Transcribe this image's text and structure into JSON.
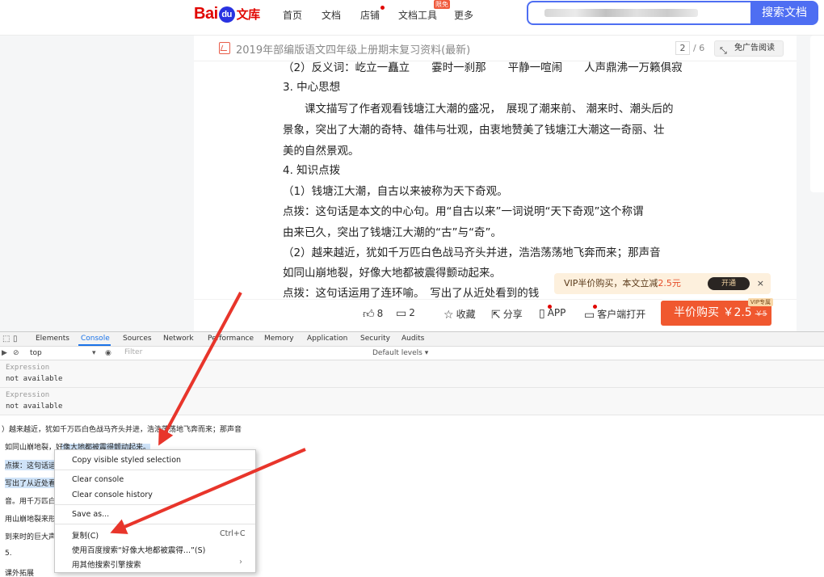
{
  "header": {
    "logo_brand": "Bai",
    "logo_paw": "du",
    "logo_suffix": "文库",
    "nav": [
      "首页",
      "文档",
      "店铺",
      "文档工具",
      "更多"
    ],
    "hot_badge": "限免",
    "search_placeholder": "",
    "search_button": "搜索文档"
  },
  "doc": {
    "title": "2019年部编版语文四年级上册期末复习资料(最新)",
    "page_current": "2",
    "page_total": "/ 6",
    "ad_free_label": "免广告阅读",
    "lines": [
      "（2）反义词：屹立一矗立　　霎时一刹那　　平静一喧闹　　人声鼎沸一万籁俱寂",
      "3. 中心思想",
      "　　课文描写了作者观看钱塘江大潮的盛况，　展现了潮来前、 潮来时、潮头后的",
      "景象，突出了大潮的奇特、雄伟与壮观，由衷地赞美了钱塘江大潮这一奇丽、壮",
      "美的自然景观。",
      "4. 知识点拨",
      "（1）钱塘江大潮，自古以来被称为天下奇观。",
      "点拨：这句话是本文的中心句。用“自古以来”一词说明“天下奇观”这个称谓",
      "由来已久，突出了钱塘江大潮的“古”与“奇”。",
      "（2）越来越近，犹如千万匹白色战马齐头并进，浩浩荡荡地飞奔而来；那声音",
      "如同山崩地裂，好像大地都被震得颤动起来。",
      "点拨：这句话运用了连环喻。　写出了从近处看到的钱"
    ],
    "toolbar": {
      "like_count": "8",
      "comment_count": "2",
      "collect": "收藏",
      "share": "分享",
      "app": "APP",
      "client_open": "客户端打开"
    },
    "buy_button": "半价购买 ￥2.5",
    "buy_old_price": "￥5",
    "vip_tag": "VIP专属",
    "vip_bar": {
      "text": "VIP半价购买，本文立减",
      "discount": "2.5元",
      "open": "开通",
      "close": "×"
    }
  },
  "devtools": {
    "tabs": [
      "Elements",
      "Console",
      "Sources",
      "Network",
      "Performance",
      "Memory",
      "Application",
      "Security",
      "Audits"
    ],
    "active_tab": "Console",
    "context": "top",
    "filter_placeholder": "Filter",
    "levels": "Default levels ▾",
    "expressions": [
      {
        "label": "Expression",
        "value": "not available"
      },
      {
        "label": "Expression",
        "value": "not available"
      }
    ],
    "console_lines": [
      "）越来越近，犹如千万匹白色战马齐头并进，浩浩荡荡地飞奔而来；那声音",
      "如同山崩地裂，好像大地都被震得颤动起来。",
      "点拨：这句话运",
      "写出了从近处看",
      "音。用千万匹白",
      "用山崩地裂来形",
      "到来时的巨大声",
      "5.",
      "课外拓展"
    ],
    "context_menu": {
      "items": [
        "Copy visible styled selection",
        "Clear console",
        "Clear console history",
        "Save as...",
        "复制(C)",
        "使用百度搜索“好像大地都被震得...”(S)",
        "用其他搜索引擎搜索"
      ],
      "copy_shortcut": "Ctrl+C"
    }
  },
  "colors": {
    "accent": "#4e6ef2",
    "brand_red": "#e10601",
    "buy_orange": "#f0582f",
    "arrow_red": "#e8352b"
  }
}
